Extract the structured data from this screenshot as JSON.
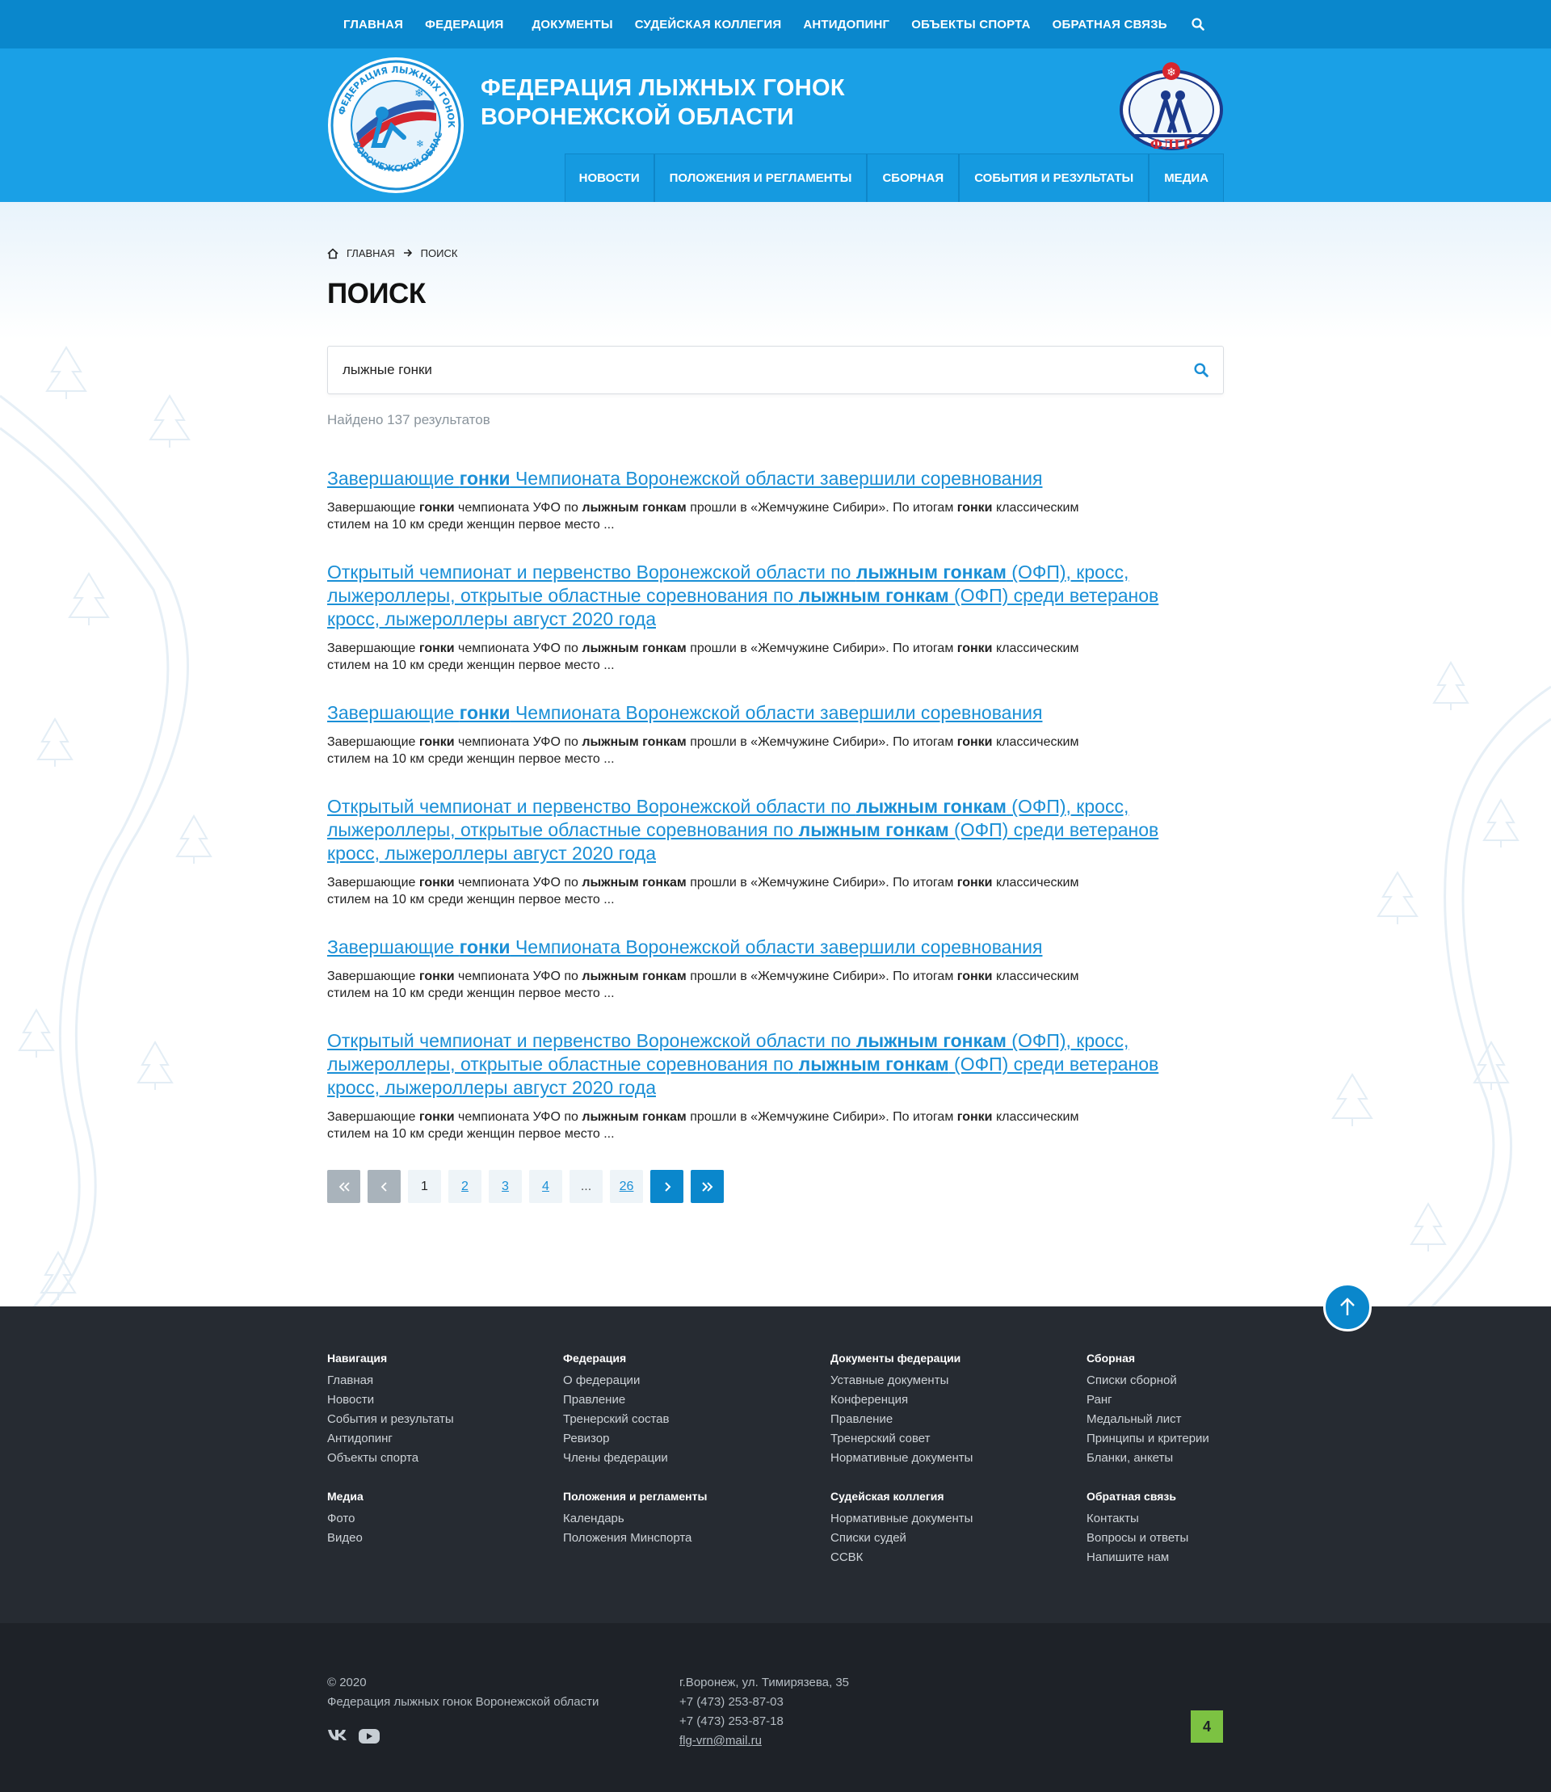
{
  "topnav": [
    "ГЛАВНАЯ",
    "ФЕДЕРАЦИЯ",
    "ДОКУМЕНТЫ",
    "СУДЕЙСКАЯ КОЛЛЕГИЯ",
    "АНТИДОПИНГ",
    "ОБЪЕКТЫ СПОРТА",
    "ОБРАТНАЯ СВЯЗЬ"
  ],
  "header": {
    "title_line1": "ФЕДЕРАЦИЯ ЛЫЖНЫХ ГОНОК",
    "title_line2": "ВОРОНЕЖСКОЙ ОБЛАСТИ",
    "logo_text": "ФЕДЕРАЦИЯ ЛЫЖНЫХ ГОНОК ВОРОНЕЖСКОЙ ОБЛАСТИ",
    "fl_logo_text": "ФЛГР"
  },
  "mainnav": [
    "НОВОСТИ",
    "ПОЛОЖЕНИЯ И РЕГЛАМЕНТЫ",
    "СБОРНАЯ",
    "СОБЫТИЯ И РЕЗУЛЬТАТЫ",
    "МЕДИА"
  ],
  "breadcrumb": {
    "home": "ГЛАВНАЯ",
    "current": "ПОИСК"
  },
  "page_title": "ПОИСК",
  "search": {
    "value": "лыжные гонки"
  },
  "found_text": "Найдено 137 результатов",
  "pagination": [
    "1",
    "2",
    "3",
    "4",
    "...",
    "26"
  ],
  "footer": {
    "columns": [
      {
        "title": "Навигация",
        "links": [
          "Главная",
          "Новости",
          "События и результаты",
          "Антидопинг",
          "Объекты спорта"
        ]
      },
      {
        "title": "Федерация",
        "links": [
          "О федерации",
          "Правление",
          "Тренерский состав",
          "Ревизор",
          "Члены федерации"
        ]
      },
      {
        "title": "Документы федерации",
        "links": [
          "Уставные документы",
          "Конференция",
          "Правление",
          "Тренерский совет",
          "Нормативные документы"
        ]
      },
      {
        "title": "Сборная",
        "links": [
          "Списки сборной",
          "Ранг",
          "Медальный лист",
          "Принципы и критерии",
          "Бланки, анкеты"
        ]
      },
      {
        "title": "Медиа",
        "links": [
          "Фото",
          "Видео"
        ]
      },
      {
        "title": "Положения и регламенты",
        "links": [
          "Календарь",
          "Положения Минспорта"
        ]
      },
      {
        "title": "Судейская коллегия",
        "links": [
          "Нормативные документы",
          "Списки судей",
          "ССВК"
        ]
      },
      {
        "title": "Обратная связь",
        "links": [
          "Контакты",
          "Вопросы и ответы",
          "Напишите нам"
        ]
      }
    ],
    "copyright": "© 2020",
    "org": "Федерация лыжных гонок Воронежской области",
    "address": "г.Воронеж, ул. Тимирязева, 35",
    "phone1": "+7 (473) 253-87-03",
    "phone2": "+7 (473) 253-87-18",
    "email": "flg-vrn@mail.ru",
    "badge": "4"
  }
}
